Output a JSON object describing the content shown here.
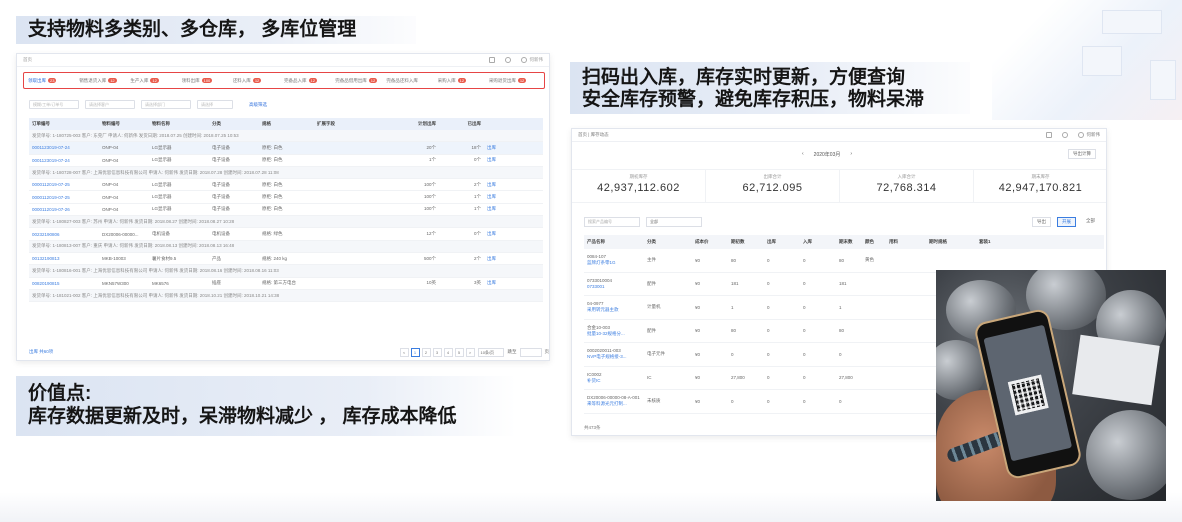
{
  "headings": {
    "feature1": "支持物料多类别、多仓库， 多库位管理",
    "feature2_line1": "扫码出入库，库存实时更新，方便查询",
    "feature2_line2": "安全库存预警，避免库存积压，物料呆滞",
    "value_title": "价值点:",
    "value_text": "库存数据更新及时，呆滞物料减少 ， 库存成本降低"
  },
  "shot1": {
    "breadcrumb": "首页",
    "user": "何新伟",
    "tabs": [
      {
        "label": "领取出库",
        "count": "23",
        "active": true
      },
      {
        "label": "销售退货入库",
        "count": "12"
      },
      {
        "label": "生产入库",
        "count": "12"
      },
      {
        "label": "领料出库",
        "count": "100"
      },
      {
        "label": "还料入库",
        "count": "12"
      },
      {
        "label": "完备品入库",
        "count": "12"
      },
      {
        "label": "完备品借用出库",
        "count": "12"
      },
      {
        "label": "完备品还料入库",
        "count": ""
      },
      {
        "label": "采购入库",
        "count": "12"
      },
      {
        "label": "采购退货出库",
        "count": "12"
      }
    ],
    "filters": [
      "模糊/工单/订单号",
      "请选择客户",
      "请选择部门",
      "请选择"
    ],
    "filter_link": "高级筛选",
    "columns": [
      "订单编号",
      "物料编号",
      "物料名称",
      "分类",
      "规格",
      "扩展字段",
      "计划出库",
      "已出库",
      ""
    ],
    "rows": [
      {
        "type": "grp",
        "text": "发货单号: 1-180725-003   客户: 东莞厂   申请人: 何新伟   发货日期: 2018.07.25   创建时间: 2018.07.25 10:53"
      },
      {
        "type": "hl",
        "cells": [
          "0001123019-07-24",
          "ONP-04",
          "LG显示器",
          "电子设备",
          "原柜: 白色",
          "",
          "20个",
          "18个",
          "出库"
        ]
      },
      {
        "type": "row",
        "cells": [
          "0001123019-07-24",
          "ONP-04",
          "LG显示器",
          "电子设备",
          "原柜: 白色",
          "",
          "1个",
          "0个",
          "出库"
        ]
      },
      {
        "type": "grp",
        "text": "发货单号: 1-180728-007   客户: 上海优思信息科技有限公司   申请人: 何新伟   发货日期: 2018.07.28   创建时间: 2018.07.28 11:08"
      },
      {
        "type": "row",
        "cells": [
          "0000112019-07-25",
          "ONP-04",
          "LG显示器",
          "电子设备",
          "原柜: 白色",
          "",
          "100个",
          "2个",
          "出库"
        ]
      },
      {
        "type": "row",
        "cells": [
          "0000112019-07-25",
          "ONP-04",
          "LG显示器",
          "电子设备",
          "原柜: 白色",
          "",
          "100个",
          "1个",
          "出库"
        ]
      },
      {
        "type": "row",
        "cells": [
          "0000112019-07-26",
          "ONP-04",
          "LG显示器",
          "电子设备",
          "原柜: 白色",
          "",
          "100个",
          "1个",
          "出库"
        ]
      },
      {
        "type": "grp",
        "text": "发货单号: 1-180827-003   客户: 苏州   申请人: 何新伟   发货日期: 2018.08.27   创建时间: 2018.08.27 10:28"
      },
      {
        "type": "row",
        "cells": [
          "00232190806",
          "DX20006-00000...",
          "电机设备",
          "电机设备",
          "规格: 绿色",
          "",
          "12个",
          "0个",
          "出库"
        ]
      },
      {
        "type": "grp",
        "text": "发货单号: 1-180813-007   客户: 重庆   申请人: 何新伟   发货日期: 2018.08.13   创建时间: 2018.08.13 16:48"
      },
      {
        "type": "row",
        "cells": [
          "00132190813",
          "MKB-10003",
          "薯片食材9.5",
          "产品",
          "规格: 240 kg",
          "",
          "500个",
          "2个",
          "出库"
        ]
      },
      {
        "type": "grp",
        "text": "发货单号: 1-180816-001   客户: 上海优思信息科技有限公司   申请人: 何新伟   发货日期: 2018.08.16   创建时间: 2018.08.16 11:03"
      },
      {
        "type": "row",
        "cells": [
          "00820190815",
          "MKN57W300",
          "MK6576",
          "插座",
          "规格: 第三方电台",
          "",
          "10英",
          "3英",
          "出库"
        ]
      },
      {
        "type": "grp",
        "text": "发货单号: 1-181021-002   客户: 上海优思信息科技有限公司   申请人: 何新伟   发货日期: 2018.10.21   创建时间: 2018.10.21 14:38"
      }
    ],
    "footer_left": "出库   共60项",
    "pages": [
      "<",
      "1",
      "2",
      "3",
      "4",
      "5",
      ">"
    ],
    "page_size": "10条/页",
    "goto": "跳至",
    "page_unit": "页"
  },
  "shot2": {
    "breadcrumb": "首页 | 库存动态",
    "user": "何新伟",
    "month": "2020年03月",
    "export": "导出计算",
    "stats": [
      {
        "label": "期初库存",
        "value": "42,937,112.602"
      },
      {
        "label": "出库合计",
        "value": "62,712.095"
      },
      {
        "label": "入库合计",
        "value": "72,768.314"
      },
      {
        "label": "期末库存",
        "value": "42,947,170.821"
      }
    ],
    "search_placeholder": "搜索产品编号",
    "select_value": "全部",
    "buttons": {
      "export": "导出",
      "open": "开展",
      "all": "全部"
    },
    "columns": [
      "产品名称",
      "分类",
      "成本价",
      "期初数",
      "出库",
      "入库",
      "期末数",
      "颜色",
      "用料",
      "期时规格",
      "套装1",
      ""
    ],
    "rows": [
      {
        "name1": "0084-107",
        "name2": "蓝牌灯条零1G",
        "cells": [
          "主件",
          "¥0",
          "80",
          "0",
          "0",
          "80",
          "黄色",
          "",
          "",
          "",
          ""
        ]
      },
      {
        "name1": "0733010004",
        "name2": "0733001",
        "cells": [
          "配件",
          "¥0",
          "181",
          "0",
          "0",
          "181",
          "",
          "",
          "",
          "",
          ""
        ]
      },
      {
        "name1": "04-0977",
        "name2": "采用转元器主款",
        "cells": [
          "计量机",
          "¥0",
          "1",
          "0",
          "0",
          "1",
          "",
          "",
          "",
          "",
          ""
        ]
      },
      {
        "name1": "合金10-003",
        "name2": "批量10-32规格分...",
        "cells": [
          "配件",
          "¥0",
          "80",
          "0",
          "0",
          "80",
          "",
          "",
          "",
          "",
          ""
        ]
      },
      {
        "name1": "0002020011-003",
        "name2": "NVP电子规格接-3...",
        "cells": [
          "电子元件",
          "¥0",
          "0",
          "0",
          "0",
          "0",
          "",
          "",
          "",
          "",
          ""
        ]
      },
      {
        "name1": "IC0002",
        "name2": "补货IC",
        "cells": [
          "IC",
          "¥0",
          "27,800",
          "0",
          "0",
          "27,800",
          "",
          "",
          "",
          "",
          ""
        ]
      },
      {
        "name1": "DX20006-00000-08-A-001",
        "name2": "来等料源光元打制...",
        "cells": [
          "未核质",
          "¥0",
          "0",
          "0",
          "0",
          "0",
          "",
          "",
          "",
          "",
          ""
        ]
      }
    ],
    "footer": "共473条"
  },
  "photo": {
    "description_icon": "phone-qr-scan-icon"
  }
}
